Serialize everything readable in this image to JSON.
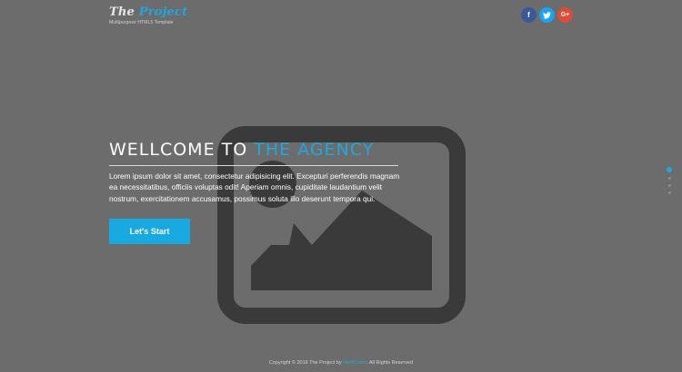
{
  "header": {
    "logo_part1": "The ",
    "logo_part2": "Project",
    "tagline": "Multipurpose HTML5 Template",
    "social": [
      {
        "name": "facebook",
        "glyph": "f",
        "color": "#3b5998"
      },
      {
        "name": "twitter",
        "glyph": "t",
        "color": "#1da1f2"
      },
      {
        "name": "google-plus",
        "glyph": "G+",
        "color": "#dd4b39"
      }
    ]
  },
  "hero": {
    "heading_part1": "WELLCOME TO ",
    "heading_part2": "THE AGENCY",
    "body": "Lorem ipsum dolor sit amet, consectetur adipisicing elit. Excepturi perferendis magnam ea necessitatibus, officiis voluptas odit! Aperiam omnis, cupiditate laudantium velit nostrum, exercitationem accusamus, possimus soluta illo deserunt tempora qui.",
    "cta_label": "Let's Start",
    "background_icon": "image-placeholder-icon"
  },
  "slider": {
    "dot_count": 4,
    "active_index": 0
  },
  "footer": {
    "prefix": "Copyright © 2016 The Project by ",
    "link": "HtmlCoder",
    "suffix": ". All Rights Reserved"
  },
  "colors": {
    "background": "#6c6c6c",
    "accent": "#21a6de",
    "cta": "#18a9e0",
    "placeholder": "#3a3a3a"
  }
}
